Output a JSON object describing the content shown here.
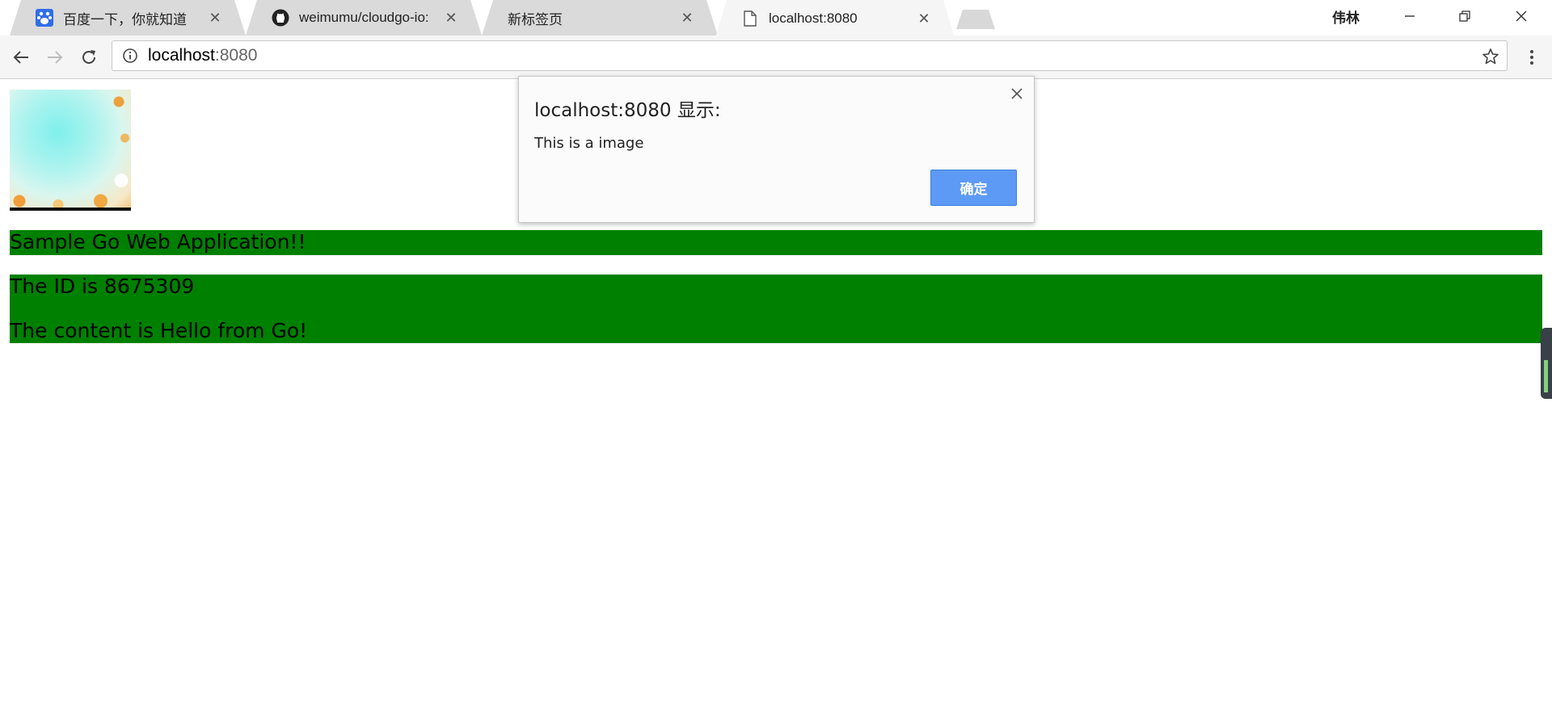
{
  "browser": {
    "tabs": [
      {
        "title": "百度一下，你就知道",
        "icon": "baidu-paw-icon",
        "active": false
      },
      {
        "title": "weimumu/cloudgo-io:",
        "icon": "github-icon",
        "active": false
      },
      {
        "title": "新标签页",
        "icon": "",
        "active": false
      },
      {
        "title": "localhost:8080",
        "icon": "page-icon",
        "active": true
      }
    ],
    "profile_name": "伟林",
    "address": {
      "host": "localhost",
      "port": ":8080"
    }
  },
  "page": {
    "heading": "Sample Go Web Application!!",
    "id_line": "The ID is 8675309",
    "content_line": "The content is Hello from Go!"
  },
  "dialog": {
    "title": "localhost:8080 显示:",
    "message": "This is a image",
    "ok_label": "确定"
  },
  "colors": {
    "banner_green": "#008000",
    "ok_button_blue": "#5d9af5"
  }
}
